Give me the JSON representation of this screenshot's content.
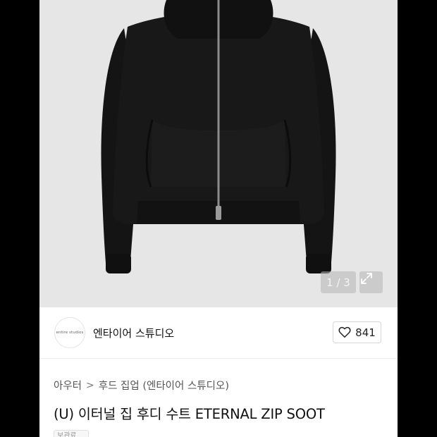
{
  "product_image": {
    "pager": "1 / 3",
    "expand_icon": "expand-arrows-icon"
  },
  "brand": {
    "logo_text": "entire studios",
    "name": "엔타이어 스튜디오"
  },
  "like": {
    "icon": "heart-outline-icon",
    "count": "841"
  },
  "breadcrumb": {
    "category": "아우터",
    "separator": ">",
    "subcategory": "후드 집업 (엔타이어 스튜디오)"
  },
  "product": {
    "title": "(U) 이터널 집 후디 수트 ETERNAL ZIP SOOT",
    "tag": "보관료"
  },
  "colors": {
    "background": "#000000",
    "image_bg": "#e6e6e6",
    "garment": "#151515"
  }
}
